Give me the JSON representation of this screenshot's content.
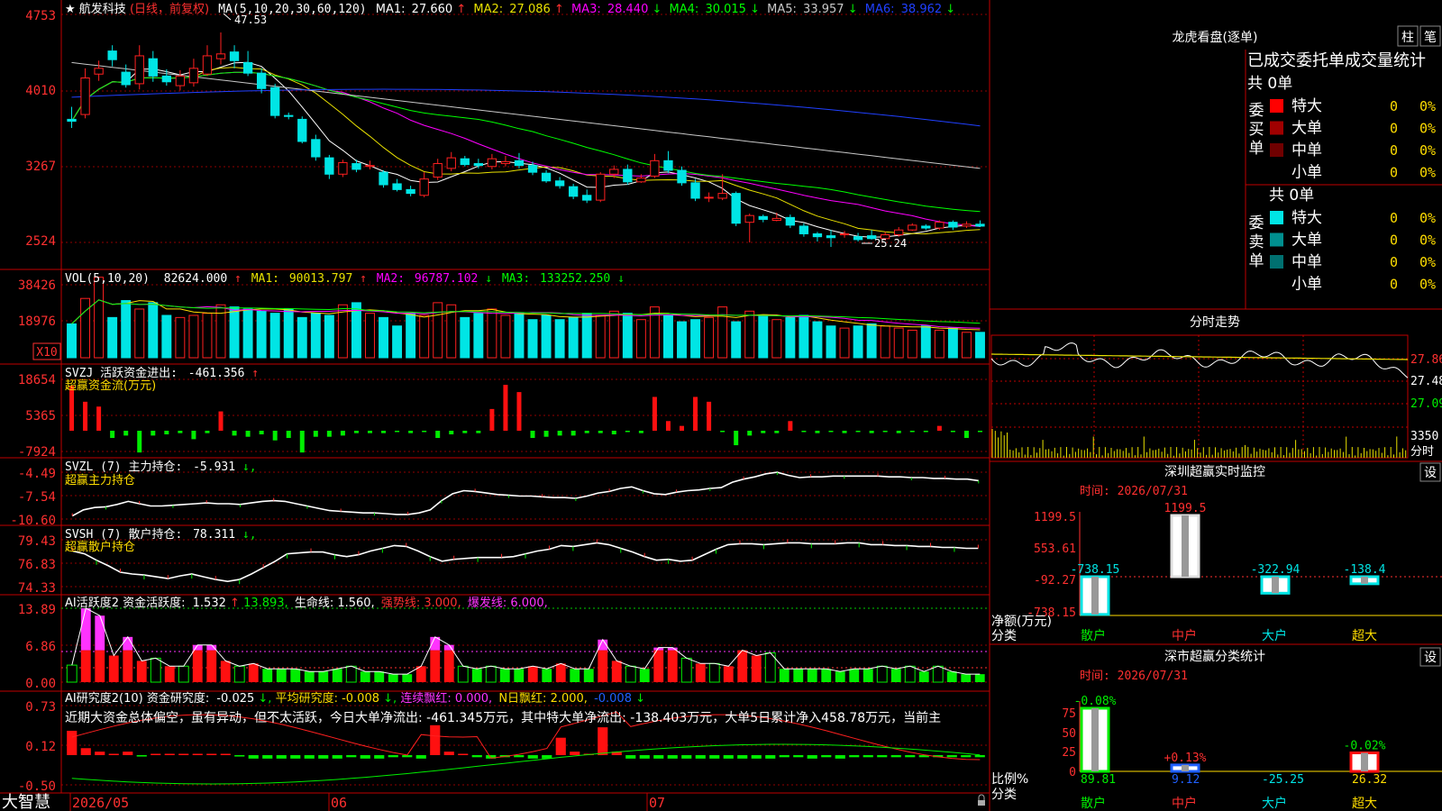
{
  "stock": {
    "star": "★",
    "name": "航发科技",
    "period": "(日线，前复权)"
  },
  "colors": {
    "up": "#ff2020",
    "down": "#00e5e5",
    "grid": "#c00000",
    "ma1": "#ffffff",
    "ma2": "#e8e000",
    "ma3": "#ff00ff",
    "ma4": "#00ff00",
    "ma5": "#c8c8c8",
    "ma6": "#2040ff",
    "green": "#00ee00",
    "magenta": "#ff33ff",
    "yellow": "#ffdd00"
  },
  "kline": {
    "ma_label": "MA(5,10,20,30,60,120)",
    "ma": [
      {
        "name": "MA1:",
        "value": "27.660",
        "arrow": "↑",
        "color": "#ffffff"
      },
      {
        "name": "MA2:",
        "value": "27.086",
        "arrow": "↑",
        "color": "#e8e000"
      },
      {
        "name": "MA3:",
        "value": "28.440",
        "arrow": "↓",
        "color": "#ff00ff"
      },
      {
        "name": "MA4:",
        "value": "30.015",
        "arrow": "↓",
        "color": "#00ff00"
      },
      {
        "name": "MA5:",
        "value": "33.957",
        "arrow": "↓",
        "color": "#c8c8c8"
      },
      {
        "name": "MA6:",
        "value": "38.962",
        "arrow": "↓",
        "color": "#2040ff"
      }
    ],
    "y_ticks": [
      "4753",
      "4010",
      "3267",
      "2524"
    ],
    "high_label": "47.53",
    "low_label": "25.24"
  },
  "vol": {
    "label": "VOL(5,10,20)",
    "value": "82624.000",
    "value_arrow": "↑",
    "ma": [
      {
        "name": "MA1:",
        "value": "90013.797",
        "arrow": "↑",
        "color": "#e8e000"
      },
      {
        "name": "MA2:",
        "value": "96787.102",
        "arrow": "↓",
        "color": "#ff00ff"
      },
      {
        "name": "MA3:",
        "value": "133252.250",
        "arrow": "↓",
        "color": "#00ff00"
      }
    ],
    "y_ticks": [
      "38426",
      "18976"
    ],
    "unit": "X10"
  },
  "svzj": {
    "label": "SVZJ  活跃资金进出:",
    "value": "-461.356",
    "arrow": "↑",
    "sub": "超赢资金流(万元)",
    "y_ticks": [
      "18654",
      "5365",
      "-7924"
    ]
  },
  "svzl": {
    "label": "SVZL (7) 主力持仓:",
    "value": "-5.931",
    "arrow": "↓,",
    "sub": "超赢主力持仓",
    "y_ticks": [
      "-4.49",
      "-7.54",
      "-10.60"
    ]
  },
  "svsh": {
    "label": "SVSH (7) 散户持仓:",
    "value": "78.311",
    "arrow": "↓,",
    "sub": "超赢散户持仓",
    "y_ticks": [
      "79.43",
      "76.83",
      "74.33"
    ]
  },
  "ai1": {
    "label": "AI活跃度2 资金活跃度:",
    "value": "1.532",
    "v2": "13.893,",
    "life": "生命线: 1.560,",
    "strong": "强势线: 3.000,",
    "burst": "爆发线: 6.000,",
    "y_ticks": [
      "13.89",
      "6.86",
      "0.00"
    ]
  },
  "ai2": {
    "label": "AI研究度2(10) 资金研究度:",
    "value": "-0.025",
    "avg": "平均研究度: -0.008",
    "lianxu": "连续飘红: 0.000,",
    "nday": "N日飘红: 2.000,",
    "neg": "-0.008",
    "text": "近期大资金总体偏空，虽有异动，但不太活跃，今日大单净流出: -461.345万元，其中特大单净流出: -138.403万元，大单5日累计净入458.78万元，当前主",
    "y_ticks": [
      "0.73",
      "0.12",
      "-0.50"
    ]
  },
  "x_axis": {
    "brand": "大智慧",
    "labels": [
      "2026/05",
      "06",
      "07"
    ]
  },
  "lhb": {
    "title": "龙虎看盘(逐单)",
    "btn_zhu": "柱",
    "btn_bi": "笔",
    "header": "已成交委托单成交量统计",
    "buy": {
      "side": [
        "委",
        "买",
        "单"
      ],
      "total": "共 0单",
      "rows": [
        {
          "label": "特大",
          "count": "0",
          "pct": "0%",
          "color": "#ff0000"
        },
        {
          "label": "大单",
          "count": "0",
          "pct": "0%",
          "color": "#a00000"
        },
        {
          "label": "中单",
          "count": "0",
          "pct": "0%",
          "color": "#700000"
        },
        {
          "label": "小单",
          "count": "0",
          "pct": "0%",
          "color": ""
        }
      ]
    },
    "sell": {
      "side": [
        "委",
        "卖",
        "单"
      ],
      "total": "共 0单",
      "rows": [
        {
          "label": "特大",
          "count": "0",
          "pct": "0%",
          "color": "#00e5e5"
        },
        {
          "label": "大单",
          "count": "0",
          "pct": "0%",
          "color": "#008f8f"
        },
        {
          "label": "中单",
          "count": "0",
          "pct": "0%",
          "color": "#007070"
        },
        {
          "label": "小单",
          "count": "0",
          "pct": "0%",
          "color": ""
        }
      ]
    }
  },
  "fenshi": {
    "title": "分时走势",
    "prices": [
      "27.86",
      "27.48",
      "27.09"
    ],
    "vol": "3350",
    "unit": "分时"
  },
  "monitor": {
    "title": "深圳超赢实时监控",
    "btn": "设",
    "time": "时间: 2026/07/31",
    "y_ticks": [
      "1199.5",
      "553.61",
      "-92.27",
      "-738.15"
    ],
    "ylabel": "净额(万元)",
    "xlabel": "分类",
    "categories": [
      "散户",
      "中户",
      "大户",
      "超大"
    ],
    "value_labels": [
      "-738.15",
      "1199.5",
      "-322.94",
      "-138.4"
    ]
  },
  "classify": {
    "title": "深市超赢分类统计",
    "btn": "设",
    "time": "时间: 2026/07/31",
    "y_ticks": [
      "75",
      "50",
      "25",
      "0"
    ],
    "ylabel": "比例%",
    "xlabel": "分类",
    "categories": [
      "散户",
      "中户",
      "大户",
      "超大"
    ],
    "top_labels": [
      "-0.08%",
      "+0.13%",
      "",
      "-0.02%"
    ],
    "bottom_labels": [
      "89.81",
      "9.12",
      "-25.25",
      "26.32"
    ]
  },
  "chart_data": [
    {
      "type": "candlestick",
      "title": "航发科技 (日线，前复权)",
      "y_ticks": [
        4753,
        4010,
        3267,
        2524
      ],
      "ylim": [
        2300,
        4900
      ],
      "candles": [
        [
          3850,
          3830,
          3980,
          3760
        ],
        [
          3900,
          4280,
          4380,
          3860
        ],
        [
          4320,
          4380,
          4460,
          4250
        ],
        [
          4560,
          4470,
          4620,
          4400
        ],
        [
          4340,
          4210,
          4420,
          4180
        ],
        [
          4220,
          4510,
          4620,
          4160
        ],
        [
          4480,
          4300,
          4560,
          4240
        ],
        [
          4300,
          4240,
          4370,
          4200
        ],
        [
          4200,
          4300,
          4360,
          4150
        ],
        [
          4230,
          4380,
          4480,
          4190
        ],
        [
          4320,
          4510,
          4620,
          4300
        ],
        [
          4480,
          4530,
          4753,
          4420
        ],
        [
          4550,
          4460,
          4620,
          4380
        ],
        [
          4440,
          4330,
          4560,
          4300
        ],
        [
          4330,
          4170,
          4380,
          4120
        ],
        [
          4180,
          3890,
          4220,
          3860
        ],
        [
          3890,
          3880,
          3920,
          3850
        ],
        [
          3850,
          3620,
          3880,
          3600
        ],
        [
          3640,
          3460,
          3690,
          3420
        ],
        [
          3450,
          3280,
          3480,
          3230
        ],
        [
          3280,
          3400,
          3430,
          3250
        ],
        [
          3390,
          3330,
          3430,
          3300
        ],
        [
          3360,
          3370,
          3420,
          3330
        ],
        [
          3300,
          3170,
          3320,
          3140
        ],
        [
          3180,
          3120,
          3230,
          3100
        ],
        [
          3120,
          3080,
          3160,
          3050
        ],
        [
          3060,
          3230,
          3300,
          3040
        ],
        [
          3250,
          3390,
          3440,
          3220
        ],
        [
          3340,
          3450,
          3510,
          3310
        ],
        [
          3440,
          3380,
          3470,
          3360
        ],
        [
          3390,
          3370,
          3440,
          3340
        ],
        [
          3360,
          3440,
          3490,
          3330
        ],
        [
          3390,
          3410,
          3470,
          3360
        ],
        [
          3420,
          3370,
          3500,
          3340
        ],
        [
          3370,
          3300,
          3410,
          3270
        ],
        [
          3290,
          3210,
          3320,
          3190
        ],
        [
          3210,
          3160,
          3250,
          3130
        ],
        [
          3150,
          3050,
          3180,
          3020
        ],
        [
          3060,
          3010,
          3120,
          2980
        ],
        [
          3010,
          3280,
          3300,
          2990
        ],
        [
          3280,
          3330,
          3370,
          3240
        ],
        [
          3330,
          3200,
          3380,
          3170
        ],
        [
          3200,
          3240,
          3280,
          3190
        ],
        [
          3260,
          3420,
          3490,
          3240
        ],
        [
          3420,
          3320,
          3520,
          3290
        ],
        [
          3320,
          3190,
          3360,
          3160
        ],
        [
          3190,
          3030,
          3230,
          3000
        ],
        [
          3040,
          3040,
          3090,
          2990
        ],
        [
          3030,
          3080,
          3280,
          3010
        ],
        [
          3080,
          2770,
          3100,
          2740
        ],
        [
          2780,
          2850,
          2870,
          2570
        ],
        [
          2840,
          2810,
          2860,
          2780
        ],
        [
          2800,
          2820,
          2880,
          2790
        ],
        [
          2830,
          2750,
          2860,
          2720
        ],
        [
          2740,
          2660,
          2770,
          2630
        ],
        [
          2660,
          2630,
          2680,
          2580
        ],
        [
          2640,
          2620,
          2700,
          2524
        ],
        [
          2650,
          2660,
          2690,
          2620
        ],
        [
          2630,
          2600,
          2670,
          2580
        ],
        [
          2640,
          2610,
          2700,
          2600
        ],
        [
          2610,
          2650,
          2680,
          2590
        ],
        [
          2650,
          2700,
          2730,
          2630
        ],
        [
          2700,
          2750,
          2770,
          2690
        ],
        [
          2740,
          2720,
          2760,
          2700
        ],
        [
          2720,
          2780,
          2800,
          2700
        ],
        [
          2780,
          2730,
          2800,
          2700
        ],
        [
          2740,
          2760,
          2790,
          2720
        ],
        [
          2760,
          2740,
          2800,
          2730
        ]
      ]
    },
    {
      "type": "bar",
      "title": "VOL(5,10,20)",
      "y_ticks": [
        38426,
        18976
      ],
      "values": [
        16,
        28,
        38,
        19,
        27,
        23,
        26,
        20,
        19,
        20,
        21,
        25,
        24,
        23,
        22,
        21,
        23,
        19,
        21,
        20,
        25,
        26,
        21,
        19,
        15,
        21,
        20,
        26,
        25,
        19,
        21,
        23,
        20,
        21,
        18,
        20,
        18,
        19,
        21,
        20,
        22,
        21,
        18,
        24,
        20,
        17,
        18,
        19,
        24,
        17,
        22,
        20,
        18,
        19,
        20,
        17,
        15,
        14,
        15,
        16,
        15,
        14,
        13,
        15,
        13,
        14,
        12,
        12
      ]
    },
    {
      "type": "bar",
      "title": "超赢资金流(万元)",
      "y_ticks": [
        18654,
        5365,
        -7924
      ],
      "values": [
        18654,
        12000,
        10000,
        -3000,
        -2000,
        -9000,
        -2000,
        -1500,
        -1000,
        -3500,
        -1000,
        8000,
        -2000,
        -2500,
        -1500,
        -4000,
        -3000,
        -9000,
        -2500,
        -2500,
        -2000,
        -1000,
        -1000,
        -1000,
        -500,
        -1000,
        -300,
        -3000,
        -1500,
        -1000,
        -1000,
        9000,
        19000,
        16000,
        -3000,
        -2500,
        -2000,
        -2000,
        -1000,
        -1000,
        -1500,
        -500,
        -1000,
        14000,
        4000,
        2000,
        14000,
        12000,
        -500,
        -6000,
        -2000,
        -1000,
        -1000,
        4000,
        -500,
        -1000,
        -300,
        -1000,
        -500,
        -1000,
        -300,
        -1000,
        -500,
        -500,
        2000,
        -500,
        -3000,
        -500
      ]
    },
    {
      "type": "line",
      "title": "超赢主力持仓",
      "y_ticks": [
        -4.49,
        -7.54,
        -10.6
      ],
      "values": [
        -10.2,
        -9.4,
        -9.1,
        -9.0,
        -8.7,
        -8.3,
        -8.6,
        -8.9,
        -8.9,
        -8.8,
        -8.7,
        -8.6,
        -8.5,
        -8.6,
        -8.6,
        -8.7,
        -8.5,
        -8.3,
        -8.2,
        -8.3,
        -8.6,
        -8.9,
        -9.2,
        -9.5,
        -9.6,
        -9.7,
        -9.8,
        -9.8,
        -9.9,
        -10.0,
        -10.0,
        -9.8,
        -9.4,
        -8.2,
        -7.3,
        -6.9,
        -7.0,
        -7.2,
        -7.4,
        -7.5,
        -7.6,
        -7.6,
        -7.7,
        -7.8,
        -7.8,
        -7.9,
        -7.6,
        -7.2,
        -7.0,
        -6.6,
        -6.4,
        -6.9,
        -7.3,
        -7.4,
        -7.1,
        -6.9,
        -6.8,
        -6.6,
        -6.5,
        -5.8,
        -5.4,
        -5.1,
        -4.7,
        -4.5,
        -4.9,
        -5.2,
        -5.1,
        -5.1,
        -5.0,
        -5.0,
        -5.0,
        -5.0,
        -5.0,
        -5.1,
        -5.1,
        -5.2,
        -5.2,
        -5.3,
        -5.3,
        -5.4,
        -5.4,
        -5.6
      ]
    },
    {
      "type": "line",
      "title": "超赢散户持仓",
      "y_ticks": [
        79.43,
        76.83,
        74.33
      ],
      "values": [
        78.2,
        77.9,
        77.2,
        76.6,
        75.9,
        75.7,
        75.6,
        75.4,
        75.2,
        75.5,
        75.7,
        75.4,
        75.1,
        74.9,
        75.1,
        75.7,
        76.4,
        77.1,
        77.9,
        78.0,
        78.1,
        78.1,
        77.8,
        77.6,
        77.8,
        78.2,
        78.5,
        78.8,
        78.7,
        78.2,
        77.6,
        77.1,
        77.3,
        77.4,
        77.5,
        77.5,
        77.5,
        77.6,
        77.9,
        78.2,
        78.4,
        78.8,
        78.7,
        78.9,
        79.1,
        78.9,
        78.5,
        78.1,
        77.6,
        77.2,
        77.3,
        77.1,
        77.2,
        77.8,
        78.4,
        78.9,
        79.0,
        79.0,
        78.9,
        79.0,
        79.1,
        79.1,
        79.0,
        79.0,
        79.0,
        79.1,
        79.1,
        78.9,
        78.9,
        78.8,
        78.8,
        78.7,
        78.7,
        78.6,
        78.6,
        78.5,
        78.5
      ]
    },
    {
      "type": "bar",
      "title": "AI活跃度2 资金活跃度",
      "y_ticks": [
        13.89,
        6.86,
        0.0
      ],
      "values": [
        3.2,
        13.9,
        12.5,
        5.0,
        8.5,
        4.0,
        4.5,
        3.0,
        3.0,
        7.0,
        7.0,
        4.0,
        3.0,
        3.5,
        2.5,
        2.5,
        2.5,
        2.0,
        2.0,
        2.5,
        3.0,
        2.0,
        2.0,
        1.5,
        1.5,
        3.0,
        8.5,
        7.0,
        3.0,
        2.5,
        3.0,
        2.5,
        2.5,
        3.0,
        2.5,
        3.5,
        2.5,
        2.5,
        8.0,
        4.0,
        3.0,
        2.5,
        6.5,
        6.5,
        4.5,
        3.5,
        3.5,
        3.0,
        6.0,
        5.0,
        5.5,
        2.5,
        2.5,
        2.5,
        2.5,
        2.0,
        2.5,
        2.5,
        3.0,
        2.5,
        3.0,
        2.0,
        3.0,
        2.0,
        1.5,
        1.5
      ]
    },
    {
      "type": "bar",
      "title": "AI研究度2(10) 资金研究度",
      "y_ticks": [
        0.73,
        0.12,
        -0.5
      ],
      "values": [
        0.35,
        0.1,
        0.05,
        0.0,
        0.05,
        -0.02,
        0.0,
        0.0,
        0.0,
        0.0,
        0.0,
        0.0,
        -0.02,
        -0.05,
        -0.05,
        -0.05,
        -0.05,
        -0.05,
        -0.05,
        -0.05,
        -0.03,
        -0.05,
        -0.05,
        -0.03,
        -0.03,
        -0.05,
        0.43,
        0.05,
        0.0,
        -0.03,
        -0.05,
        -0.03,
        -0.03,
        -0.05,
        -0.05,
        0.25,
        0.05,
        0.0,
        0.4,
        0.05,
        -0.05,
        -0.05,
        -0.05,
        -0.05,
        -0.05,
        -0.05,
        -0.05,
        -0.05,
        -0.05,
        -0.05,
        -0.05,
        -0.03,
        -0.03,
        -0.05,
        -0.03,
        -0.05,
        -0.03,
        -0.03,
        -0.03,
        -0.03,
        -0.03,
        -0.03,
        -0.03,
        -0.03,
        -0.03,
        -0.03
      ]
    },
    {
      "type": "bar",
      "title": "深圳超赢实时监控",
      "categories": [
        "散户",
        "中户",
        "大户",
        "超大"
      ],
      "values": [
        -738.15,
        1199.5,
        -322.94,
        -138.4
      ],
      "ylabel": "净额(万元)",
      "xlabel": "分类",
      "y_ticks": [
        1199.5,
        553.61,
        -92.27,
        -738.15
      ]
    },
    {
      "type": "bar",
      "title": "深市超赢分类统计",
      "categories": [
        "散户",
        "中户",
        "大户",
        "超大"
      ],
      "values": [
        89.81,
        9.12,
        -25.25,
        26.32
      ],
      "ylabel": "比例%",
      "xlabel": "分类",
      "y_ticks": [
        75,
        50,
        25,
        0
      ]
    }
  ]
}
